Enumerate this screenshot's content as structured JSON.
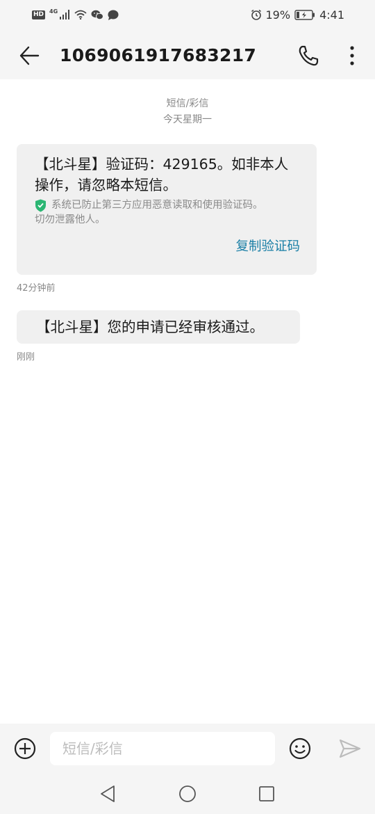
{
  "status_bar": {
    "hd_label": "HD",
    "network_label": "4G",
    "battery_percent": "19%",
    "time": "4:41",
    "icons": [
      "hd-icon",
      "signal-icon",
      "wifi-icon",
      "wechat-icon",
      "message-icon",
      "alarm-icon",
      "battery-charging-icon"
    ]
  },
  "header": {
    "contact_number": "1069061917683217",
    "icons": [
      "back-arrow-icon",
      "phone-icon",
      "more-vertical-icon"
    ]
  },
  "conversation": {
    "type_label": "短信/彩信",
    "date_label": "今天星期一",
    "messages": [
      {
        "text": "【北斗星】验证码：429165。如非本人操作，请忽略本短信。",
        "security_note_line1": "系统已防止第三方应用恶意读取和使用验证码。",
        "security_note_line2": "切勿泄露他人。",
        "action_label": "复制验证码",
        "timestamp": "42分钟前"
      },
      {
        "text": "【北斗星】您的申请已经审核通过。",
        "timestamp": "刚刚"
      }
    ]
  },
  "composer": {
    "placeholder": "短信/彩信",
    "icons": [
      "add-circle-icon",
      "emoji-icon",
      "send-icon"
    ]
  },
  "nav_bar": {
    "icons": [
      "nav-back-icon",
      "nav-home-icon",
      "nav-recent-icon"
    ]
  },
  "colors": {
    "accent": "#1a7fa6",
    "bubble": "#f0f0f0",
    "bar_bg": "#f5f5f5",
    "shield_green": "#2bb673"
  }
}
